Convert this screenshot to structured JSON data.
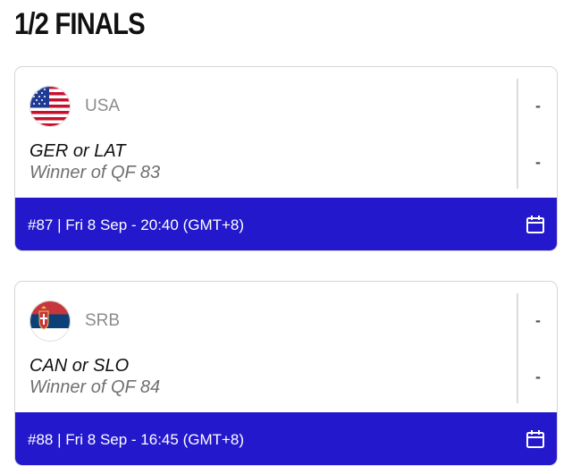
{
  "page": {
    "title": "1/2 FINALS"
  },
  "games": [
    {
      "team1": {
        "code": "USA",
        "flag_icon": "usa-flag-icon",
        "score": "-"
      },
      "team2": {
        "name": "GER or LAT",
        "sub": "Winner of QF 83",
        "score": "-"
      },
      "info": "#87 | Fri 8 Sep - 20:40 (GMT+8)",
      "calendar_icon": "calendar-icon"
    },
    {
      "team1": {
        "code": "SRB",
        "flag_icon": "serbia-flag-icon",
        "score": "-"
      },
      "team2": {
        "name": "CAN or SLO",
        "sub": "Winner of QF 84",
        "score": "-"
      },
      "info": "#88 | Fri 8 Sep - 16:45 (GMT+8)",
      "calendar_icon": "calendar-icon"
    }
  ],
  "colors": {
    "accent": "#2318cc",
    "border": "#d6d6d6",
    "muted_text": "#8c8c8c"
  }
}
